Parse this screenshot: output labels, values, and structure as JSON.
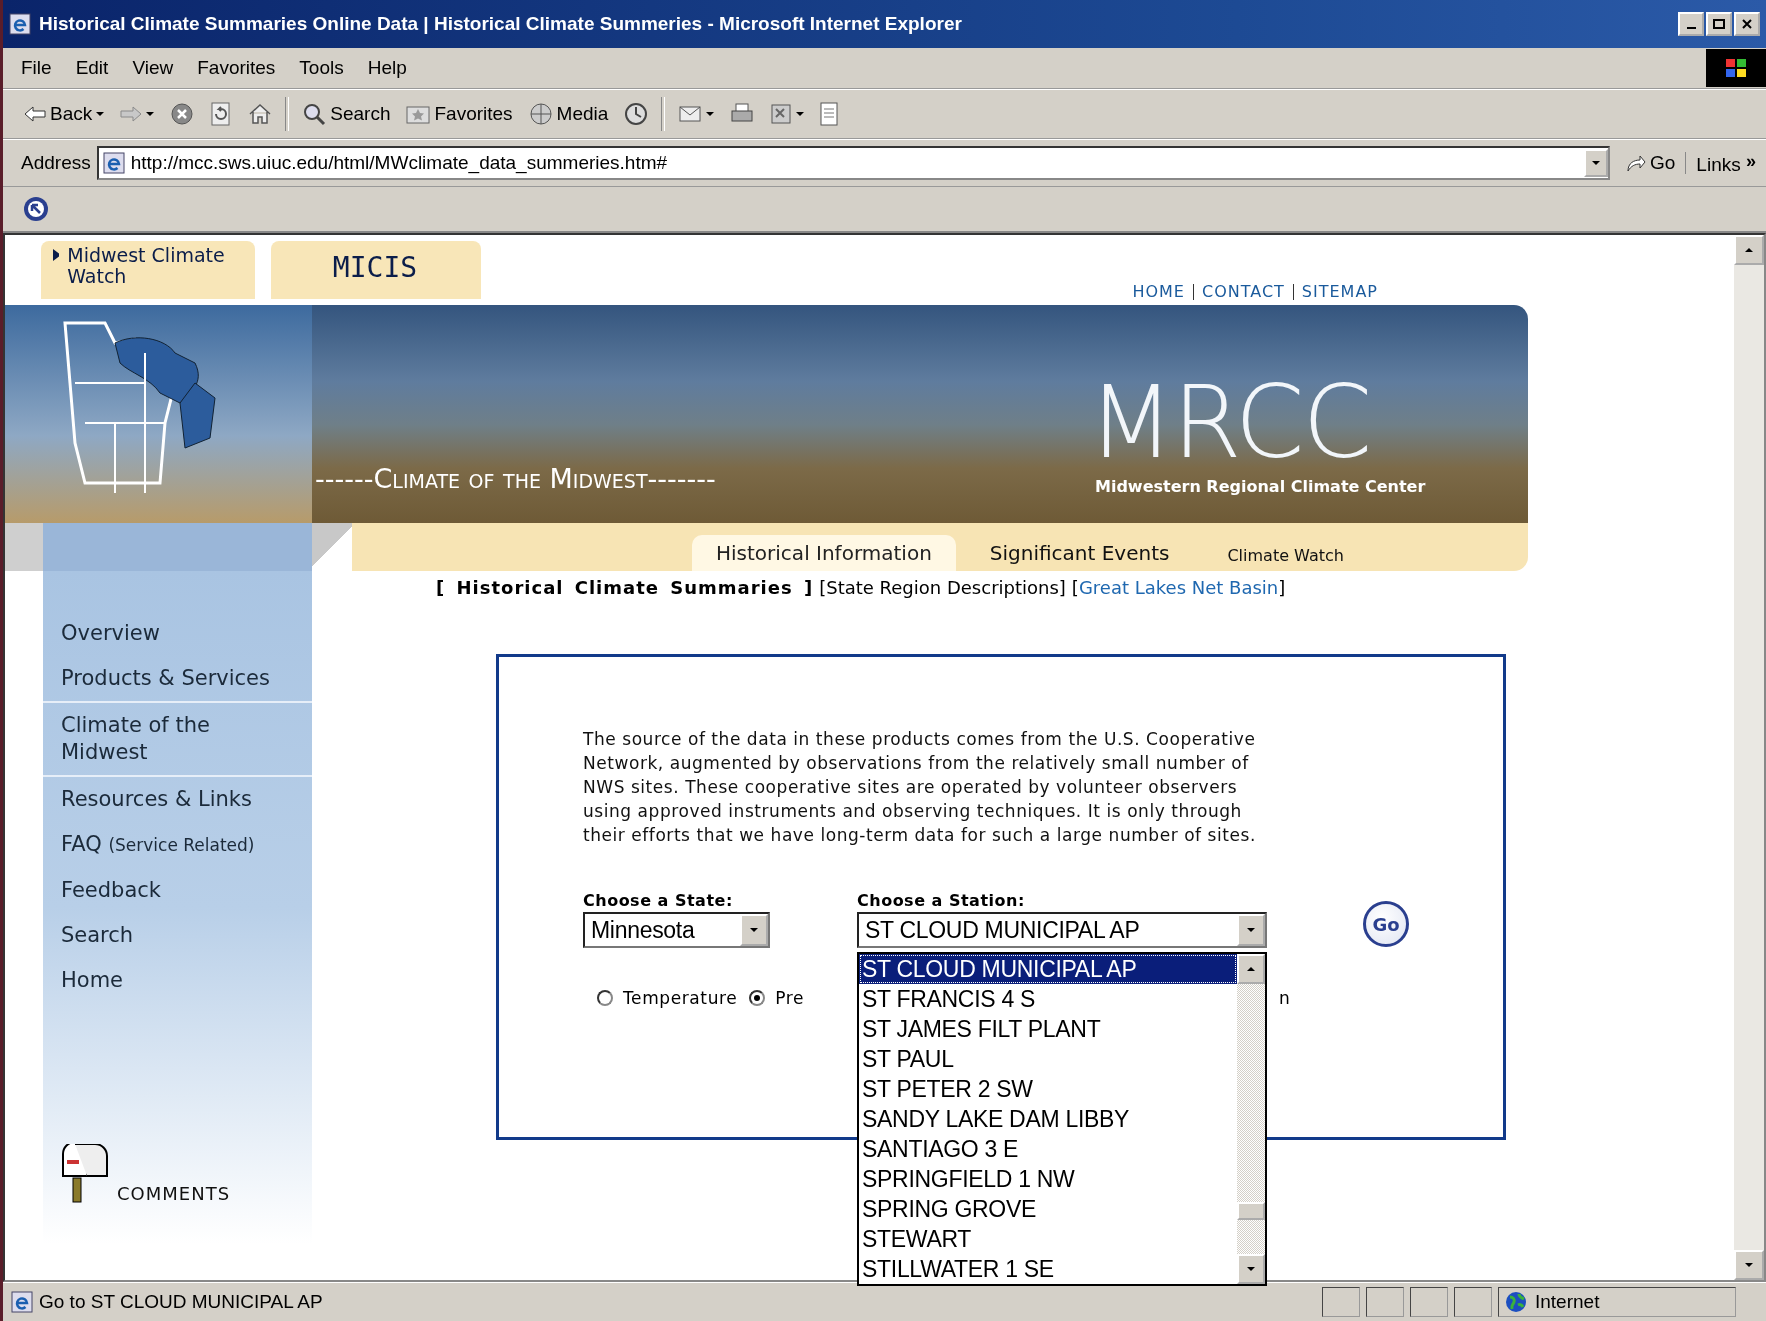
{
  "window": {
    "title": "Historical Climate Summaries Online Data | Historical Climate Summeries - Microsoft Internet Explorer"
  },
  "menu": [
    "File",
    "Edit",
    "View",
    "Favorites",
    "Tools",
    "Help"
  ],
  "toolbar": [
    {
      "kind": "back",
      "label": "Back",
      "has_menu": true
    },
    {
      "kind": "forward",
      "has_menu": true
    },
    {
      "kind": "stop"
    },
    {
      "kind": "refresh"
    },
    {
      "kind": "home"
    },
    {
      "kind": "separator"
    },
    {
      "kind": "search",
      "label": "Search"
    },
    {
      "kind": "favorites",
      "label": "Favorites"
    },
    {
      "kind": "media",
      "label": "Media"
    },
    {
      "kind": "history"
    },
    {
      "kind": "separator"
    },
    {
      "kind": "mail",
      "has_menu": true
    },
    {
      "kind": "print"
    },
    {
      "kind": "edit",
      "has_menu": true
    },
    {
      "kind": "discuss"
    }
  ],
  "address": {
    "label": "Address",
    "value": "http://mcc.sws.uiuc.edu/html/MWclimate_data_summeries.htm#",
    "go": "Go",
    "links": "Links",
    "links_chevron": "»"
  },
  "page": {
    "top_tabs": [
      {
        "label": "Midwest Climate Watch",
        "has_arrow": true
      },
      {
        "label": "MICIS",
        "has_arrow": false
      }
    ],
    "top_links": [
      "HOME",
      "CONTACT",
      "SITEMAP"
    ],
    "banner": {
      "title": "------Climate of the Midwest-------",
      "logo": "MRCC",
      "subtitle": "Midwestern Regional Climate Center"
    },
    "section_tabs": [
      {
        "label": "Historical Information",
        "selected": true
      },
      {
        "label": "Significant Events",
        "selected": false
      },
      {
        "label": "Climate Watch",
        "selected": false
      }
    ],
    "subnav": [
      {
        "open": "[",
        "label": "Historical Climate Summaries",
        "close": "]",
        "kind": "current"
      },
      {
        "open": "[",
        "label": "State Region Descriptions",
        "close": "]",
        "kind": "plain"
      },
      {
        "open": "[",
        "label": "Great Lakes Net Basin",
        "close": "]",
        "kind": "link"
      }
    ],
    "sidebar": [
      {
        "label": "Overview",
        "divider_after": false
      },
      {
        "label": "Products & Services",
        "divider_after": true
      },
      {
        "label": "Climate of the Midwest",
        "divider_after": true
      },
      {
        "label": "Resources & Links",
        "divider_after": false
      },
      {
        "label": "FAQ",
        "note": "(Service Related)",
        "divider_after": false
      },
      {
        "label": "Feedback",
        "divider_after": false
      },
      {
        "label": "Search",
        "divider_after": false
      },
      {
        "label": "Home",
        "divider_after": false
      }
    ],
    "comments": "COMMENTS",
    "form": {
      "intro": "The source of the data in these products comes from the U.S. Cooperative Network, augmented by observations from the relatively small number of NWS sites. These cooperative sites are operated by volunteer observers using approved instruments and observing techniques. It is only through their efforts that we have long-term data for such a large number of sites.",
      "state_label": "Choose a State:",
      "state_value": "Minnesota",
      "station_label": "Choose a Station:",
      "station_value": "ST CLOUD MUNICIPAL AP",
      "go": "Go",
      "radios": [
        {
          "label": "Temperature",
          "selected": false
        },
        {
          "label": "Pre",
          "selected": true
        }
      ],
      "radio_tail": "n",
      "station_options": [
        {
          "label": "ST CLOUD MUNICIPAL AP",
          "selected": true
        },
        {
          "label": "ST FRANCIS 4 S",
          "selected": false
        },
        {
          "label": "ST JAMES FILT PLANT",
          "selected": false
        },
        {
          "label": "ST PAUL",
          "selected": false
        },
        {
          "label": "ST PETER 2 SW",
          "selected": false
        },
        {
          "label": "SANDY LAKE DAM LIBBY",
          "selected": false
        },
        {
          "label": "SANTIAGO 3 E",
          "selected": false
        },
        {
          "label": "SPRINGFIELD 1 NW",
          "selected": false
        },
        {
          "label": "SPRING GROVE",
          "selected": false
        },
        {
          "label": "STEWART",
          "selected": false
        },
        {
          "label": "STILLWATER 1 SE",
          "selected": false
        }
      ]
    }
  },
  "status_bar": {
    "text": "Go to ST CLOUD MUNICIPAL AP",
    "zone": "Internet"
  }
}
